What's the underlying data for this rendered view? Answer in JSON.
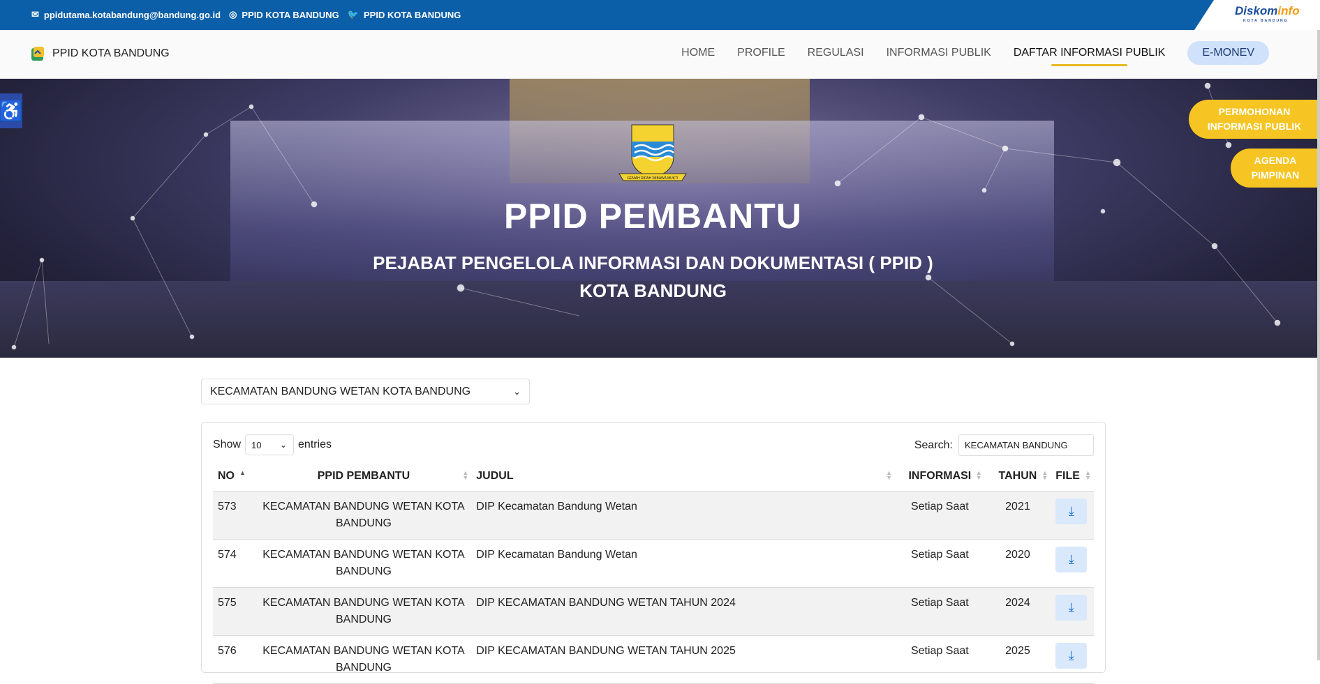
{
  "topbar": {
    "email": "ppidutama.kotabandung@bandung.go.id",
    "instagram": "PPID KOTA BANDUNG",
    "twitter": "PPID KOTA BANDUNG",
    "logo_main": "Diskom",
    "logo_accent": "info",
    "logo_sub": "KOTA BANDUNG"
  },
  "navbar": {
    "brand": "PPID KOTA BANDUNG",
    "items": [
      {
        "label": "HOME"
      },
      {
        "label": "PROFILE"
      },
      {
        "label": "REGULASI"
      },
      {
        "label": "INFORMASI PUBLIK"
      },
      {
        "label": "DAFTAR INFORMASI PUBLIK"
      }
    ],
    "emonev": "E-MONEV"
  },
  "hero": {
    "title": "PPID PEMBANTU",
    "subtitle_line1": "PEJABAT PENGELOLA INFORMASI DAN DOKUMENTASI ( PPID )",
    "subtitle_line2": "KOTA BANDUNG",
    "crest_motto": "GEMAH RIPAH WIBAWA MUKTI"
  },
  "floating": {
    "permohonan_1": "PERMOHONAN",
    "permohonan_2": "INFORMASI PUBLIK",
    "agenda_1": "AGENDA",
    "agenda_2": "PIMPINAN"
  },
  "filter": {
    "selected": "KECAMATAN BANDUNG WETAN KOTA BANDUNG"
  },
  "table_controls": {
    "show_label": "Show",
    "page_size": "10",
    "entries_label": "entries",
    "search_label": "Search:",
    "search_value": "KECAMATAN BANDUNG"
  },
  "table": {
    "headers": {
      "no": "NO",
      "ppid": "PPID PEMBANTU",
      "judul": "JUDUL",
      "informasi": "INFORMASI",
      "tahun": "TAHUN",
      "file": "FILE"
    },
    "rows": [
      {
        "no": "573",
        "ppid": "KECAMATAN BANDUNG WETAN KOTA BANDUNG",
        "judul": "DIP Kecamatan Bandung Wetan",
        "informasi": "Setiap Saat",
        "tahun": "2021"
      },
      {
        "no": "574",
        "ppid": "KECAMATAN BANDUNG WETAN KOTA BANDUNG",
        "judul": "DIP Kecamatan Bandung Wetan",
        "informasi": "Setiap Saat",
        "tahun": "2020"
      },
      {
        "no": "575",
        "ppid": "KECAMATAN BANDUNG WETAN KOTA BANDUNG",
        "judul": "DIP KECAMATAN BANDUNG WETAN TAHUN 2024",
        "informasi": "Setiap Saat",
        "tahun": "2024"
      },
      {
        "no": "576",
        "ppid": "KECAMATAN BANDUNG WETAN KOTA BANDUNG",
        "judul": "DIP KECAMATAN BANDUNG WETAN TAHUN 2025",
        "informasi": "Setiap Saat",
        "tahun": "2025"
      }
    ]
  }
}
